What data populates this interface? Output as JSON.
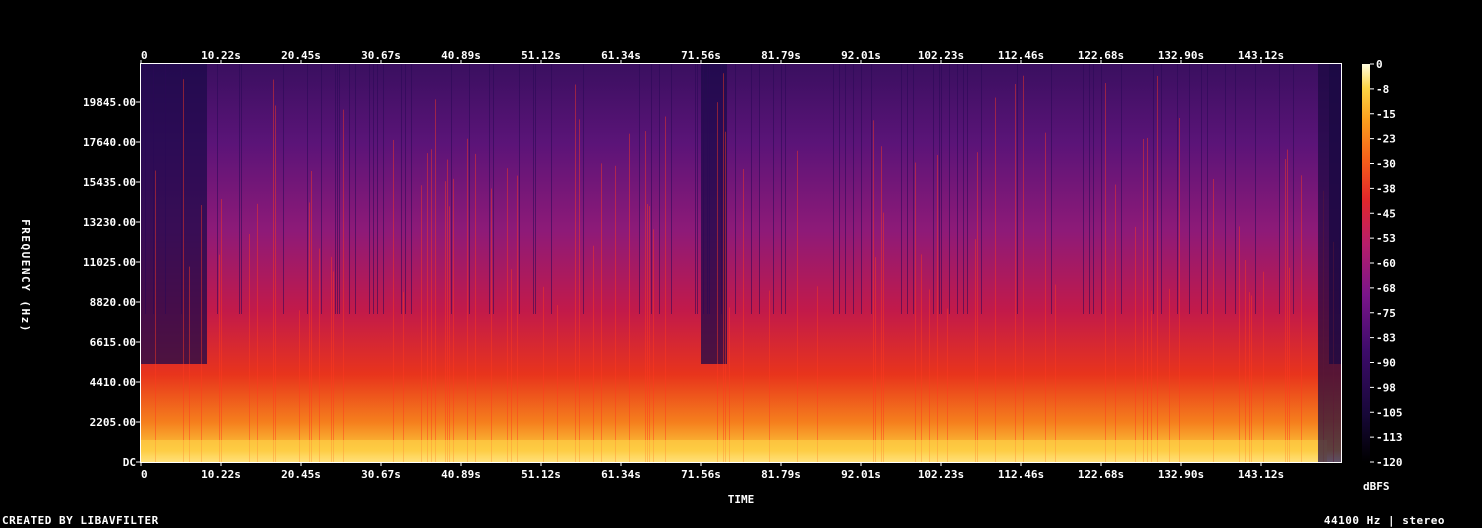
{
  "chart_data": {
    "type": "heatmap",
    "xlabel": "TIME",
    "ylabel": "FREQUENCY (Hz)",
    "x_ticks": [
      "0",
      "10.22s",
      "20.45s",
      "30.67s",
      "40.89s",
      "51.12s",
      "61.34s",
      "71.56s",
      "81.79s",
      "92.01s",
      "102.23s",
      "112.46s",
      "122.68s",
      "132.90s",
      "143.12s"
    ],
    "y_ticks": [
      "DC",
      "2205.00",
      "4410.00",
      "6615.00",
      "8820.00",
      "11025.00",
      "13230.00",
      "15435.00",
      "17640.00",
      "19845.00"
    ],
    "xlim": [
      0,
      153.35
    ],
    "ylim": [
      0,
      22050
    ],
    "colorbar": {
      "unit": "dBFS",
      "ticks": [
        "0",
        "-8",
        "-15",
        "-23",
        "-30",
        "-38",
        "-45",
        "-53",
        "-60",
        "-68",
        "-75",
        "-83",
        "-90",
        "-98",
        "-105",
        "-113",
        "-120"
      ],
      "range": [
        -120,
        0
      ],
      "colormap": [
        "#000000",
        "#1a0848",
        "#4b0c6b",
        "#7a1a8a",
        "#b01e72",
        "#e0262c",
        "#f4591a",
        "#fb9a1c",
        "#fbd13a",
        "#fffbd0"
      ]
    }
  },
  "footer": {
    "left": "CREATED BY LIBAVFILTER",
    "right": "44100 Hz | stereo"
  }
}
